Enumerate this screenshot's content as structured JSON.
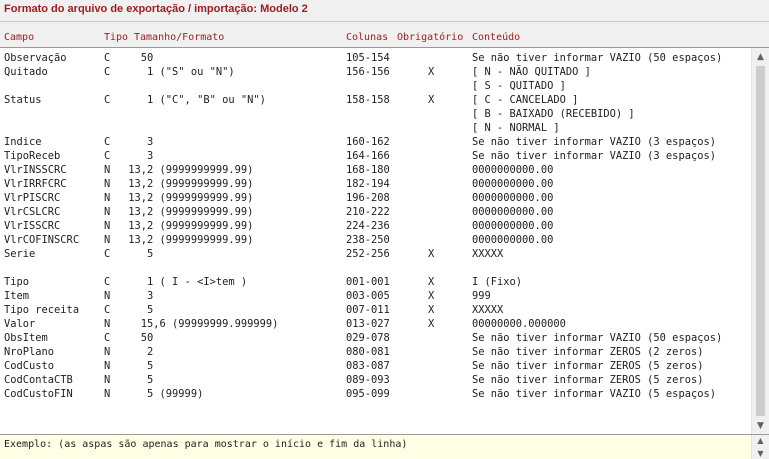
{
  "title": "Formato do arquivo de exportação / importação: Modelo 2",
  "columns": {
    "campo": "Campo",
    "tipo": "Tipo",
    "tamanho": "Tamanho/Formato",
    "colunas": "Colunas",
    "obrigatorio": "Obrigatório",
    "conteudo": "Conteúdo"
  },
  "rows": [
    {
      "campo": "Observação",
      "tipo": "C",
      "tamanho": "   50",
      "colunas": "105-154",
      "obr": "",
      "conteudo": "Se não tiver informar VAZIO (50 espaços)"
    },
    {
      "campo": "Quitado",
      "tipo": "C",
      "tamanho": "    1 (\"S\" ou \"N\")",
      "colunas": "156-156",
      "obr": "X",
      "conteudo": "[ N - NÃO QUITADO ]"
    },
    {
      "campo": "",
      "tipo": "",
      "tamanho": "",
      "colunas": "",
      "obr": "",
      "conteudo": "[ S - QUITADO ]"
    },
    {
      "campo": "Status",
      "tipo": "C",
      "tamanho": "    1 (\"C\", \"B\" ou \"N\")",
      "colunas": "158-158",
      "obr": "X",
      "conteudo": "[ C - CANCELADO ]"
    },
    {
      "campo": "",
      "tipo": "",
      "tamanho": "",
      "colunas": "",
      "obr": "",
      "conteudo": "[ B - BAIXADO (RECEBIDO) ]"
    },
    {
      "campo": "",
      "tipo": "",
      "tamanho": "",
      "colunas": "",
      "obr": "",
      "conteudo": "[ N - NORMAL ]"
    },
    {
      "campo": "Indice",
      "tipo": "C",
      "tamanho": "    3",
      "colunas": "160-162",
      "obr": "",
      "conteudo": "Se não tiver informar VAZIO (3 espaços)"
    },
    {
      "campo": "TipoReceb",
      "tipo": "C",
      "tamanho": "    3",
      "colunas": "164-166",
      "obr": "",
      "conteudo": "Se não tiver informar VAZIO (3 espaços)"
    },
    {
      "campo": "VlrINSSCRC",
      "tipo": "N",
      "tamanho": " 13,2 (9999999999.99)",
      "colunas": "168-180",
      "obr": "",
      "conteudo": "0000000000.00"
    },
    {
      "campo": "VlrIRRFCRC",
      "tipo": "N",
      "tamanho": " 13,2 (9999999999.99)",
      "colunas": "182-194",
      "obr": "",
      "conteudo": "0000000000.00"
    },
    {
      "campo": "VlrPISCRC",
      "tipo": "N",
      "tamanho": " 13,2 (9999999999.99)",
      "colunas": "196-208",
      "obr": "",
      "conteudo": "0000000000.00"
    },
    {
      "campo": "VlrCSLCRC",
      "tipo": "N",
      "tamanho": " 13,2 (9999999999.99)",
      "colunas": "210-222",
      "obr": "",
      "conteudo": "0000000000.00"
    },
    {
      "campo": "VlrISSCRC",
      "tipo": "N",
      "tamanho": " 13,2 (9999999999.99)",
      "colunas": "224-236",
      "obr": "",
      "conteudo": "0000000000.00"
    },
    {
      "campo": "VlrCOFINSCRC",
      "tipo": "N",
      "tamanho": " 13,2 (9999999999.99)",
      "colunas": "238-250",
      "obr": "",
      "conteudo": "0000000000.00"
    },
    {
      "campo": "Serie",
      "tipo": "C",
      "tamanho": "    5",
      "colunas": "252-256",
      "obr": "X",
      "conteudo": "XXXXX"
    },
    {
      "campo": "",
      "tipo": "",
      "tamanho": "",
      "colunas": "",
      "obr": "",
      "conteudo": ""
    },
    {
      "campo": "Tipo",
      "tipo": "C",
      "tamanho": "    1 ( I - <I>tem )",
      "colunas": "001-001",
      "obr": "X",
      "conteudo": "I (Fixo)"
    },
    {
      "campo": "Item",
      "tipo": "N",
      "tamanho": "    3",
      "colunas": "003-005",
      "obr": "X",
      "conteudo": "999"
    },
    {
      "campo": "Tipo receita",
      "tipo": "C",
      "tamanho": "    5",
      "colunas": "007-011",
      "obr": "X",
      "conteudo": "XXXXX"
    },
    {
      "campo": "Valor",
      "tipo": "N",
      "tamanho": "   15,6 (99999999.999999)",
      "colunas": "013-027",
      "obr": "X",
      "conteudo": "00000000.000000"
    },
    {
      "campo": "ObsItem",
      "tipo": "C",
      "tamanho": "   50",
      "colunas": "029-078",
      "obr": "",
      "conteudo": "Se não tiver informar VAZIO (50 espaços)"
    },
    {
      "campo": "NroPlano",
      "tipo": "N",
      "tamanho": "    2",
      "colunas": "080-081",
      "obr": "",
      "conteudo": "Se não tiver informar ZEROS (2 zeros)"
    },
    {
      "campo": "CodCusto",
      "tipo": "N",
      "tamanho": "    5",
      "colunas": "083-087",
      "obr": "",
      "conteudo": "Se não tiver informar ZEROS (5 zeros)"
    },
    {
      "campo": "CodContaCTB",
      "tipo": "N",
      "tamanho": "    5",
      "colunas": "089-093",
      "obr": "",
      "conteudo": "Se não tiver informar ZEROS (5 zeros)"
    },
    {
      "campo": "CodCustoFIN",
      "tipo": "N",
      "tamanho": "    5 (99999)",
      "colunas": "095-099",
      "obr": "",
      "conteudo": "Se não tiver informar VAZIO (5 espaços)"
    }
  ],
  "example": "Exemplo: (as aspas são apenas para mostrar o início e fim da linha)",
  "icons": {
    "scroll_up": "chevron-up-icon",
    "scroll_down": "chevron-down-icon"
  }
}
